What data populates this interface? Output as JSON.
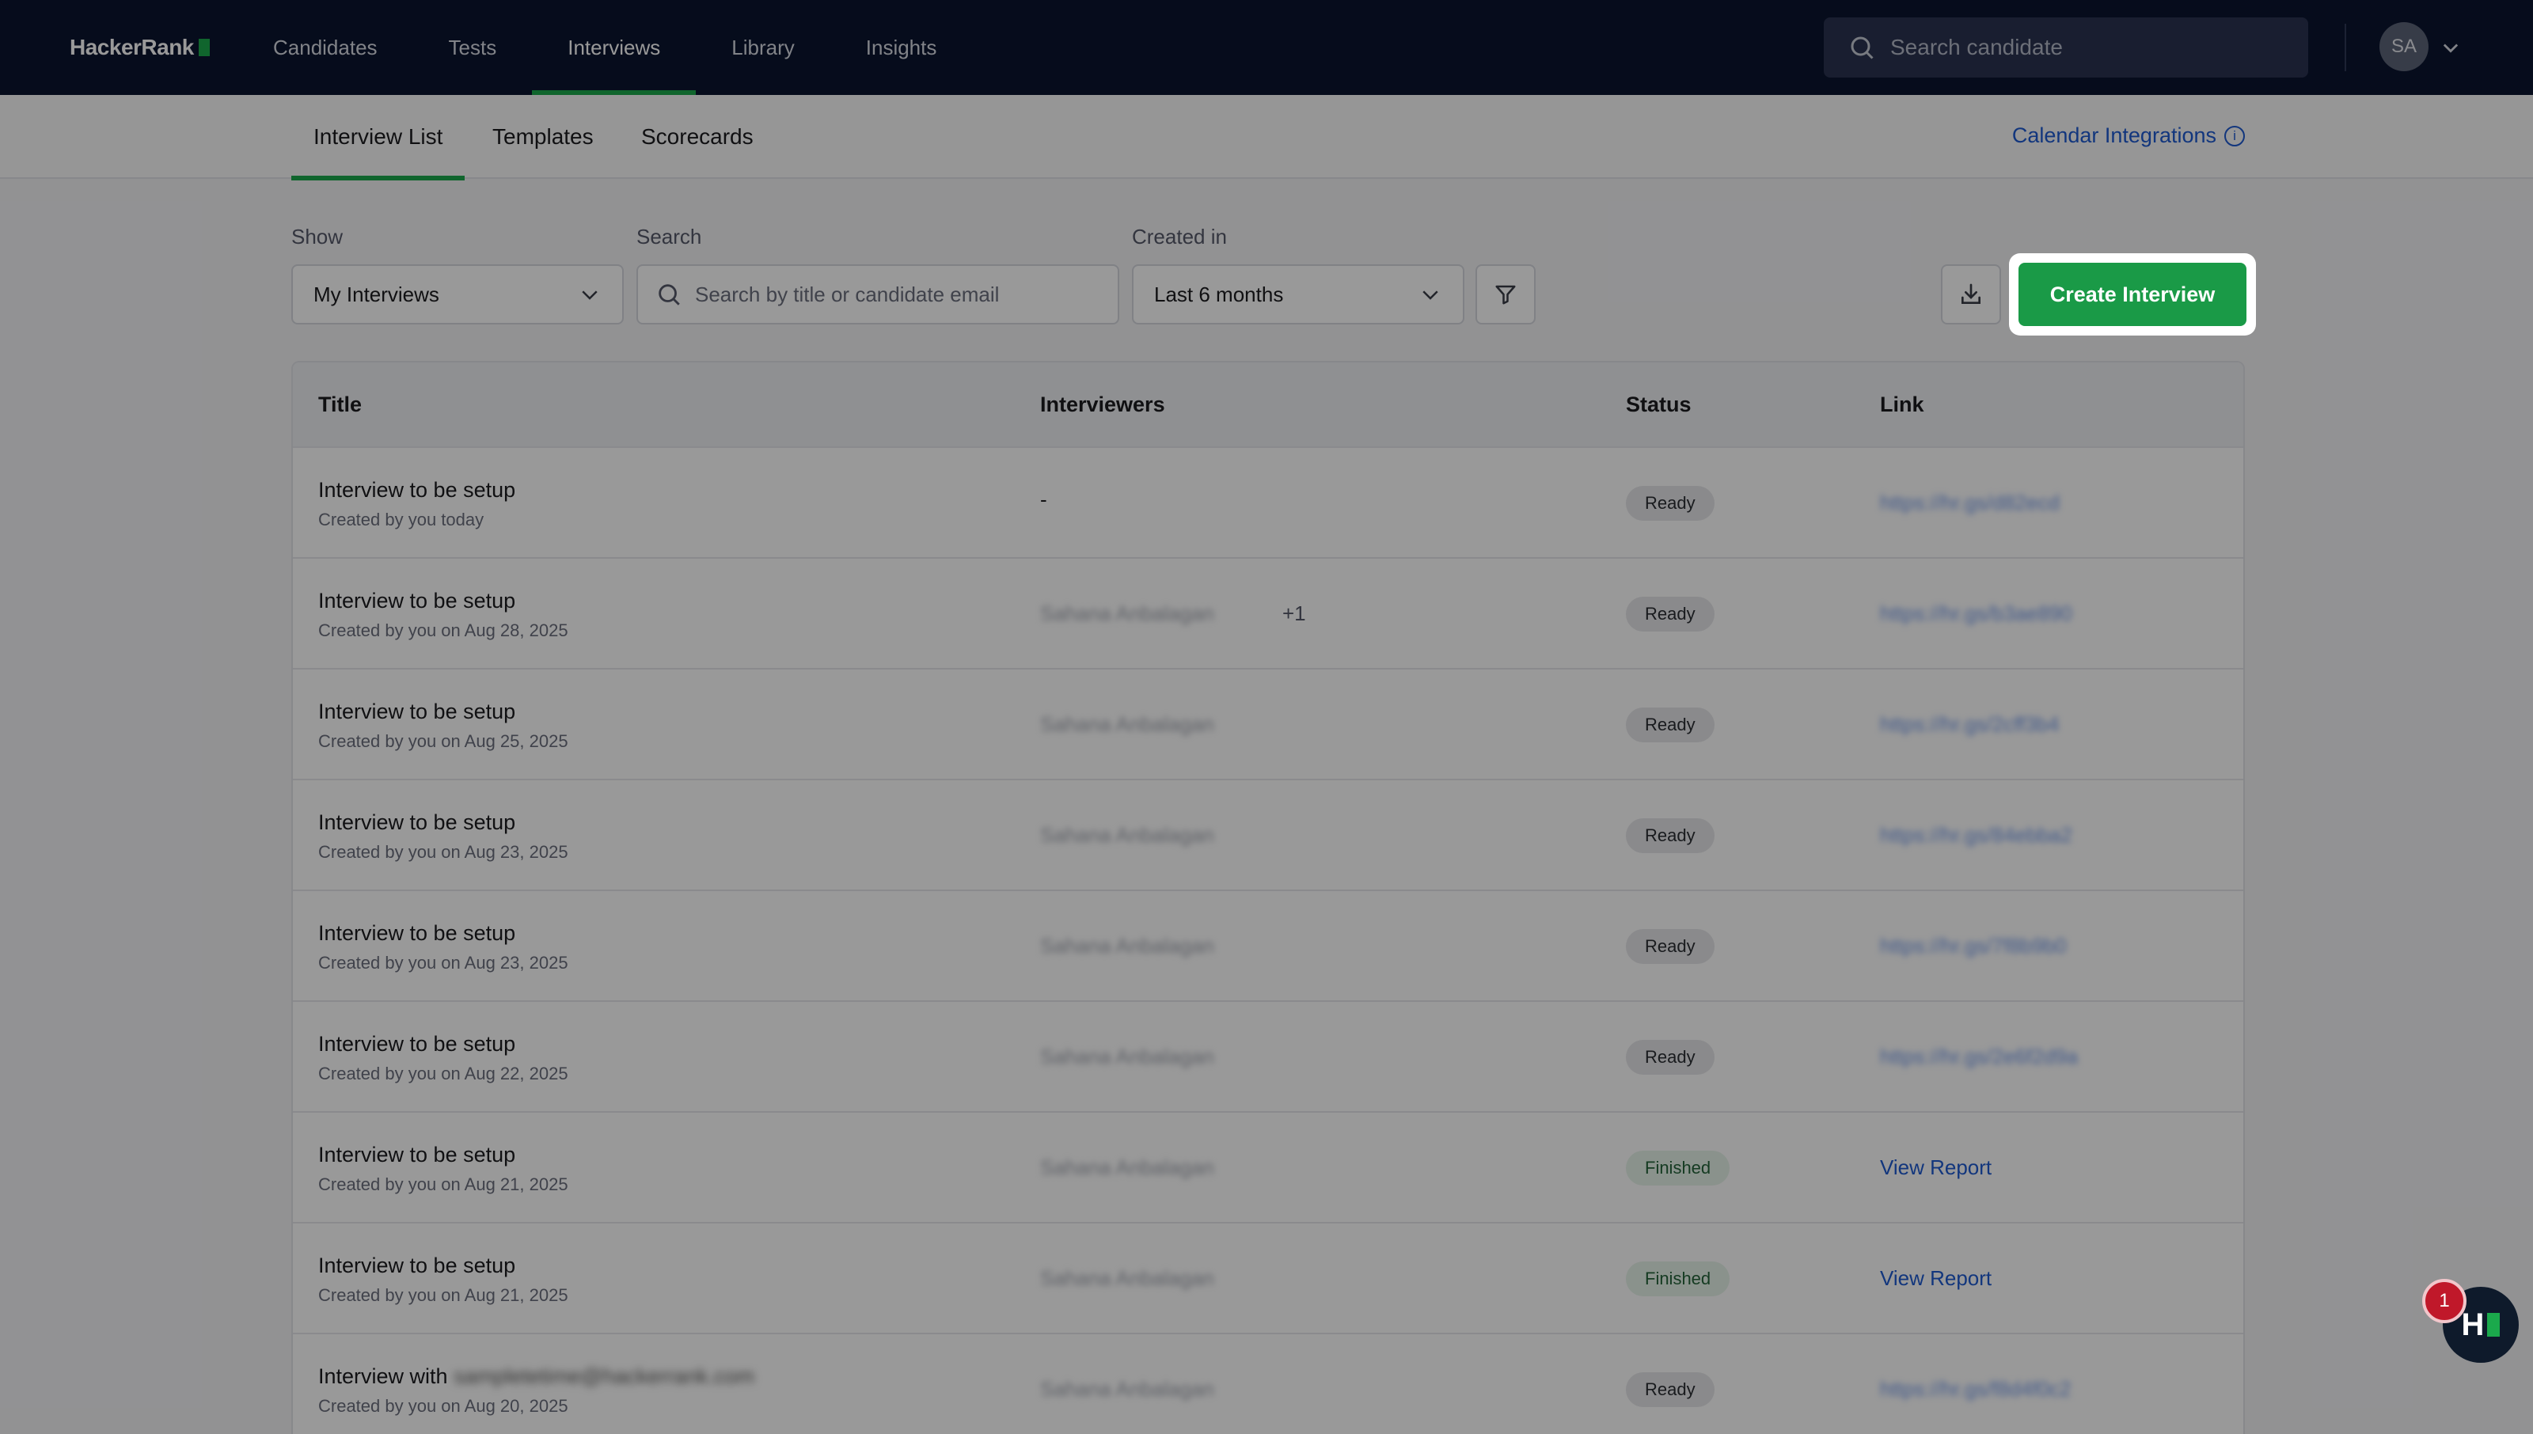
{
  "app": {
    "logo": "HackerRank"
  },
  "nav": {
    "items": [
      {
        "label": "Candidates"
      },
      {
        "label": "Tests"
      },
      {
        "label": "Interviews"
      },
      {
        "label": "Library"
      },
      {
        "label": "Insights"
      }
    ],
    "active": "Interviews",
    "search_placeholder": "Search candidate",
    "avatar_initials": "SA"
  },
  "subtabs": {
    "items": [
      {
        "label": "Interview List"
      },
      {
        "label": "Templates"
      },
      {
        "label": "Scorecards"
      }
    ],
    "active": "Interview List",
    "calendar_link": "Calendar Integrations"
  },
  "filters": {
    "show_label": "Show",
    "show_value": "My Interviews",
    "search_label": "Search",
    "search_placeholder": "Search by title or candidate email",
    "created_label": "Created in",
    "created_value": "Last 6 months"
  },
  "actions": {
    "create_label": "Create Interview"
  },
  "table": {
    "headers": {
      "title": "Title",
      "interviewers": "Interviewers",
      "status": "Status",
      "link": "Link"
    },
    "rows": [
      {
        "title": "Interview to be setup",
        "sub": "Created by you today",
        "interviewers": "-",
        "extra": "",
        "status": "Ready",
        "link": "https://hr.gs/d82ecd"
      },
      {
        "title": "Interview to be setup",
        "sub": "Created by you on Aug 28, 2025",
        "interviewers": "Sahana Anbalagan",
        "extra": "+1",
        "status": "Ready",
        "link": "https://hr.gs/b3ae890"
      },
      {
        "title": "Interview to be setup",
        "sub": "Created by you on Aug 25, 2025",
        "interviewers": "Sahana Anbalagan",
        "extra": "",
        "status": "Ready",
        "link": "https://hr.gs/2cff3b4"
      },
      {
        "title": "Interview to be setup",
        "sub": "Created by you on Aug 23, 2025",
        "interviewers": "Sahana Anbalagan",
        "extra": "",
        "status": "Ready",
        "link": "https://hr.gs/84ebba2"
      },
      {
        "title": "Interview to be setup",
        "sub": "Created by you on Aug 23, 2025",
        "interviewers": "Sahana Anbalagan",
        "extra": "",
        "status": "Ready",
        "link": "https://hr.gs/7f8b9b0"
      },
      {
        "title": "Interview to be setup",
        "sub": "Created by you on Aug 22, 2025",
        "interviewers": "Sahana Anbalagan",
        "extra": "",
        "status": "Ready",
        "link": "https://hr.gs/2e6f2d9a"
      },
      {
        "title": "Interview to be setup",
        "sub": "Created by you on Aug 21, 2025",
        "interviewers": "Sahana Anbalagan",
        "extra": "",
        "status": "Finished",
        "link": "View Report"
      },
      {
        "title": "Interview to be setup",
        "sub": "Created by you on Aug 21, 2025",
        "interviewers": "Sahana Anbalagan",
        "extra": "",
        "status": "Finished",
        "link": "View Report"
      },
      {
        "title": "Interview with",
        "title_email": "sampletetime@hackerrank.com",
        "sub": "Created by you on Aug 20, 2025",
        "interviewers": "Sahana Anbalagan",
        "extra": "",
        "status": "Ready",
        "link": "https://hr.gs/f8d4f0c2"
      }
    ]
  },
  "widget": {
    "badge_count": "1",
    "label": "H"
  },
  "colors": {
    "nav_bg": "#0b1530",
    "accent_green": "#1ba94c",
    "button_green": "#1a9a47",
    "link_blue": "#1f5bd1"
  },
  "icons": {
    "search": "search-icon",
    "chevron": "chevron-down-icon",
    "filter": "filter-icon",
    "download": "download-icon",
    "info": "info-icon"
  }
}
